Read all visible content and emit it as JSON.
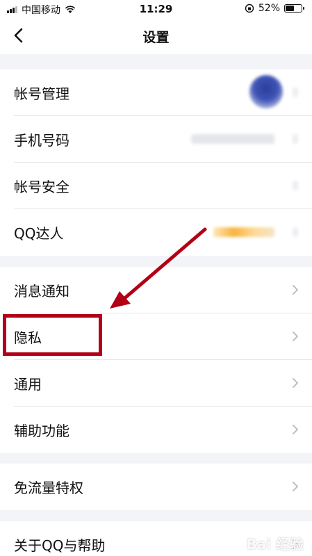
{
  "status_bar": {
    "carrier": "中国移动",
    "time": "11:29",
    "battery": "52%",
    "battery_level": 0.52
  },
  "nav": {
    "title": "设置"
  },
  "groups": [
    {
      "items": [
        {
          "label": "帐号管理"
        },
        {
          "label": "手机号码"
        },
        {
          "label": "帐号安全"
        },
        {
          "label": "QQ达人"
        }
      ]
    },
    {
      "items": [
        {
          "label": "消息通知"
        },
        {
          "label": "隐私"
        },
        {
          "label": "通用"
        },
        {
          "label": "辅助功能"
        }
      ]
    },
    {
      "items": [
        {
          "label": "免流量特权"
        }
      ]
    },
    {
      "items": [
        {
          "label": "关于QQ与帮助"
        }
      ]
    }
  ],
  "annotation": {
    "color": "#b30015"
  },
  "watermark": "Bai 经验"
}
